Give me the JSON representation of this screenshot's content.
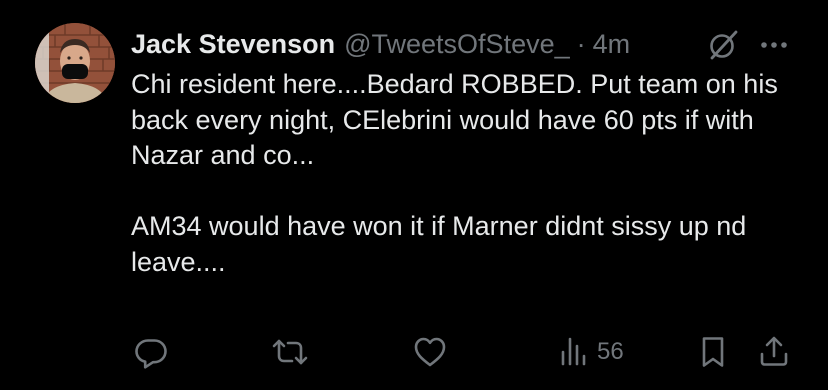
{
  "tweet": {
    "author_name": "Jack Stevenson",
    "handle": "@TweetsOfSteve_",
    "separator": "·",
    "time": "4m",
    "body": [
      "Chi resident here....Bedard ROBBED. Put team on his back every night, CElebrini would have 60 pts if with Nazar and co...",
      "AM34 would have won it if Marner didnt sissy up nd leave...."
    ]
  },
  "actions": {
    "reply_icon": "reply-icon",
    "retweet_icon": "retweet-icon",
    "like_icon": "like-icon",
    "views_icon": "views-icon",
    "views_count": "56",
    "bookmark_icon": "bookmark-icon",
    "share_icon": "share-icon"
  },
  "colors": {
    "background": "#000000",
    "primary_text": "#e7e9ea",
    "secondary_text": "#71767b"
  }
}
